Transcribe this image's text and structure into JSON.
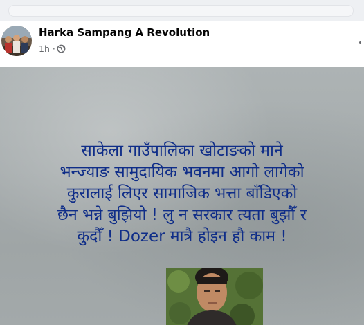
{
  "post": {
    "author": "Harka Sampang A Revolution",
    "time": "1h ·",
    "privacy_icon": "globe-icon",
    "text_lines": [
      "साकेला गाउँपालिका खोटाङको माने",
      "भन्ज्याङ सामुदायिक भवनमा आगो लागेको",
      "कुरालाई लिएर सामाजिक भत्ता बाँडिएको",
      "छैन भन्ने बुझियो ! लु न सरकार त्यता बुझौँ र",
      "कुदौँ ! Dozer मात्रै होइन हौ काम !"
    ],
    "text_color": "#0f2d88"
  }
}
